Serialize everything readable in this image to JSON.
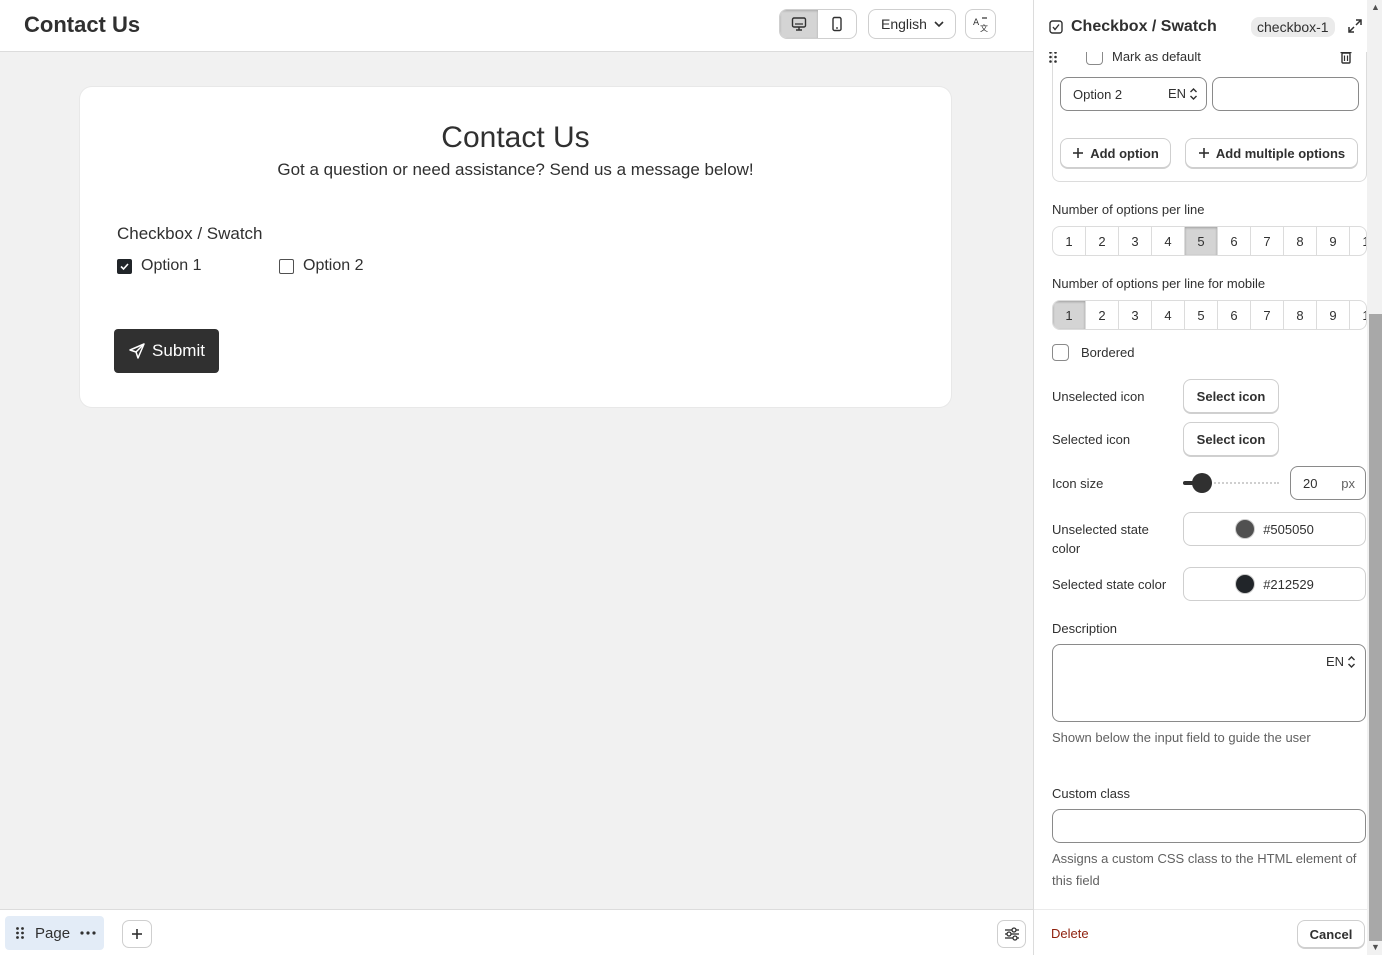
{
  "header": {
    "title": "Contact Us",
    "language": "English"
  },
  "form": {
    "title": "Contact Us",
    "subtitle": "Got a question or need assistance? Send us a message below!",
    "field_label": "Checkbox / Swatch",
    "options": [
      {
        "label": "Option 1",
        "checked": true
      },
      {
        "label": "Option 2",
        "checked": false
      }
    ],
    "submit_label": "Submit"
  },
  "bottom": {
    "page_label": "Page"
  },
  "panel": {
    "title": "Checkbox / Swatch",
    "badge": "checkbox-1",
    "mark_default": "Mark as default",
    "option_value": "Option 2",
    "option_lang": "EN",
    "add_option": "Add option",
    "add_multiple": "Add multiple options",
    "per_line_label": "Number of options per line",
    "per_line_values": [
      "1",
      "2",
      "3",
      "4",
      "5",
      "6",
      "7",
      "8",
      "9",
      "1"
    ],
    "per_line_selected": "5",
    "per_line_mobile_label": "Number of options per line for mobile",
    "per_line_mobile_selected": "1",
    "bordered_label": "Bordered",
    "unselected_icon_label": "Unselected icon",
    "selected_icon_label": "Selected icon",
    "select_icon": "Select icon",
    "icon_size_label": "Icon size",
    "icon_size_value": "20",
    "icon_size_unit": "px",
    "unselected_color_label": "Unselected state color",
    "unselected_color": "#505050",
    "selected_color_label": "Selected state color",
    "selected_color": "#212529",
    "description_label": "Description",
    "description_lang": "EN",
    "description_help": "Shown below the input field to guide the user",
    "custom_class_label": "Custom class",
    "custom_class_help": "Assigns a custom CSS class to the HTML element of this field",
    "delete_label": "Delete",
    "cancel_label": "Cancel"
  },
  "colors": {
    "accent_dark": "#303030",
    "delete_red": "#8e1f0b",
    "page_chip": "#e3ecf7"
  }
}
